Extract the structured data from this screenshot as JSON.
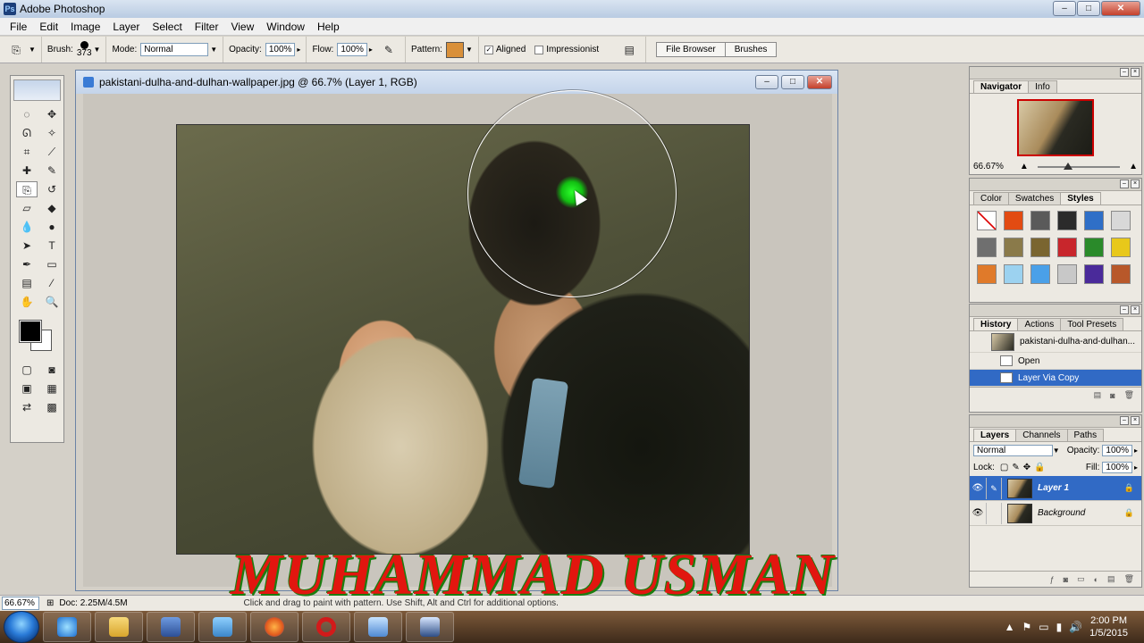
{
  "window": {
    "title": "Adobe Photoshop",
    "controls": {
      "minimize": "–",
      "maximize": "□",
      "close": "✕"
    }
  },
  "menu": [
    "File",
    "Edit",
    "Image",
    "Layer",
    "Select",
    "Filter",
    "View",
    "Window",
    "Help"
  ],
  "options": {
    "brush_label": "Brush:",
    "brush_size": "373",
    "mode_label": "Mode:",
    "mode_value": "Normal",
    "opacity_label": "Opacity:",
    "opacity_value": "100%",
    "flow_label": "Flow:",
    "flow_value": "100%",
    "pattern_label": "Pattern:",
    "pattern_color": "#d9903a",
    "aligned_label": "Aligned",
    "aligned_checked": true,
    "impressionist_label": "Impressionist",
    "impressionist_checked": false,
    "palette_well": [
      "File Browser",
      "Brushes"
    ]
  },
  "document": {
    "title": "pakistani-dulha-and-dulhan-wallpaper.jpg @ 66.7% (Layer 1, RGB)"
  },
  "navigator": {
    "tabs": [
      "Navigator",
      "Info"
    ],
    "zoom": "66.67%"
  },
  "styles_panel": {
    "tabs": [
      "Color",
      "Swatches",
      "Styles"
    ],
    "swatches": [
      "#ffffff",
      "#e24b12",
      "#5a5a5a",
      "#2b2b2b",
      "#2f6fc7",
      "#d8d8d8",
      "#6f6f6f",
      "#8a7a4a",
      "#7a6530",
      "#c8262c",
      "#2a8a2a",
      "#e8c81a",
      "#e07a2a",
      "#9cd2f0",
      "#4aa0e8",
      "#c8c8c8",
      "#4a2a9a",
      "#b8582a"
    ]
  },
  "history": {
    "tabs": [
      "History",
      "Actions",
      "Tool Presets"
    ],
    "snapshot": "pakistani-dulha-and-dulhan...",
    "items": [
      "Open",
      "Layer Via Copy"
    ]
  },
  "layers": {
    "tabs": [
      "Layers",
      "Channels",
      "Paths"
    ],
    "blend_mode": "Normal",
    "opacity_label": "Opacity:",
    "opacity_value": "100%",
    "lock_label": "Lock:",
    "fill_label": "Fill:",
    "fill_value": "100%",
    "items": [
      "Layer 1",
      "Background"
    ]
  },
  "status": {
    "zoom": "66.67%",
    "doc_info": "Doc: 2.25M/4.5M",
    "hint": "Click and drag to paint with pattern. Use Shift, Alt and Ctrl for additional options."
  },
  "watermark": "MUHAMMAD USMAN",
  "taskbar": {
    "time": "2:00 PM",
    "date": "1/5/2015",
    "apps": [
      "start",
      "internet-explorer",
      "file-explorer",
      "save-disk",
      "editor",
      "firefox",
      "opera",
      "screen-app",
      "photoshop"
    ]
  }
}
